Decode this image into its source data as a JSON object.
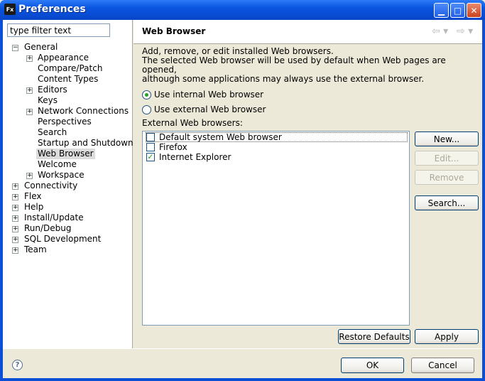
{
  "window": {
    "title": "Preferences",
    "app_icon": "Fx"
  },
  "filter": {
    "placeholder": "type filter text",
    "value": "type filter text"
  },
  "tree": {
    "general": "General",
    "appearance": "Appearance",
    "compare_patch": "Compare/Patch",
    "content_types": "Content Types",
    "editors": "Editors",
    "keys": "Keys",
    "network_connections": "Network Connections",
    "perspectives": "Perspectives",
    "search": "Search",
    "startup_shutdown": "Startup and Shutdown",
    "web_browser": "Web Browser",
    "welcome": "Welcome",
    "workspace": "Workspace",
    "connectivity": "Connectivity",
    "flex": "Flex",
    "help": "Help",
    "install_update": "Install/Update",
    "run_debug": "Run/Debug",
    "sql_development": "SQL Development",
    "team": "Team"
  },
  "page": {
    "title": "Web Browser",
    "desc_line1": "Add, remove, or edit installed Web browsers.",
    "desc_line2": "The selected Web browser will be used by default when Web pages are opened,",
    "desc_line3": "although some applications may always use the external browser.",
    "radio_internal": "Use internal Web browser",
    "radio_external": "Use external Web browser",
    "selected_radio": "internal",
    "list_label": "External Web browsers:",
    "browsers": [
      {
        "name": "Default system Web browser",
        "checked": false
      },
      {
        "name": "Firefox",
        "checked": false
      },
      {
        "name": "Internet Explorer",
        "checked": true
      }
    ],
    "btn_new": "New...",
    "btn_edit": "Edit...",
    "btn_remove": "Remove",
    "btn_search": "Search...",
    "btn_restore": "Restore Defaults",
    "btn_apply": "Apply"
  },
  "footer": {
    "ok": "OK",
    "cancel": "Cancel"
  },
  "colors": {
    "titlebar": "#0A55E0",
    "dialog_bg": "#ECE9D8",
    "selected_tree_bg": "#DCDCDC"
  }
}
